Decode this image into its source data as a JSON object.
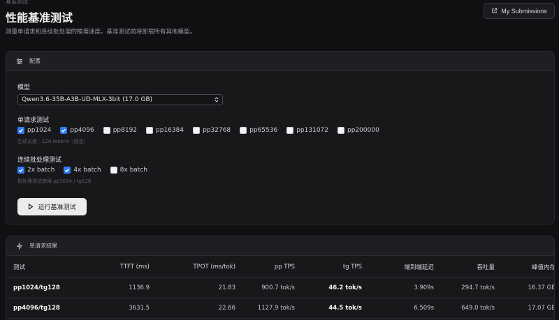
{
  "breadcrumb": "基准测试",
  "page": {
    "title": "性能基准测试",
    "description": "测量单请求和连续批处理的推理速度。基准测试前将卸载所有其他模型。"
  },
  "header_actions": {
    "submissions_label": "My Submissions"
  },
  "config": {
    "title": "配置",
    "model_label": "模型",
    "model_value": "Qwen3.6-35B-A3B-UD-MLX-3bit (17.0 GB)",
    "single_label": "单请求测试",
    "single_options": [
      {
        "label": "pp1024",
        "checked": true
      },
      {
        "label": "pp4096",
        "checked": true
      },
      {
        "label": "pp8192",
        "checked": false
      },
      {
        "label": "pp16384",
        "checked": false
      },
      {
        "label": "pp32768",
        "checked": false
      },
      {
        "label": "pp65536",
        "checked": false
      },
      {
        "label": "pp131072",
        "checked": false
      },
      {
        "label": "pp200000",
        "checked": false
      }
    ],
    "single_hint": "生成长度：128 tokens（固定）",
    "batch_label": "连续批处理测试",
    "batch_options": [
      {
        "label": "2x batch",
        "checked": true
      },
      {
        "label": "4x batch",
        "checked": true
      },
      {
        "label": "8x batch",
        "checked": false
      }
    ],
    "batch_hint": "批处理测试使用 pp1024 / tg128",
    "run_label": "运行基准测试"
  },
  "results": {
    "title": "单请求结果",
    "columns": [
      "测试",
      "TTFT (ms)",
      "TPOT (ms/tok)",
      "pp TPS",
      "tg TPS",
      "端到端延迟",
      "吞吐量",
      "峰值内存"
    ],
    "rows": [
      [
        "pp1024/tg128",
        "1136.9",
        "21.83",
        "900.7 tok/s",
        "46.2 tok/s",
        "3.909s",
        "294.7 tok/s",
        "16.37 GB"
      ],
      [
        "pp4096/tg128",
        "3631.5",
        "22.66",
        "1127.9 tok/s",
        "44.5 tok/s",
        "6.509s",
        "649.0 tok/s",
        "17.07 GB"
      ]
    ]
  }
}
